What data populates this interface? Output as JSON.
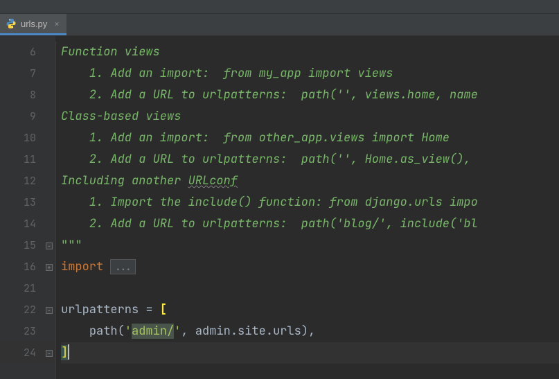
{
  "tab": {
    "filename": "urls.py",
    "icon": "python-file-icon",
    "close_glyph": "×"
  },
  "gutter": {
    "lines": [
      "6",
      "7",
      "8",
      "9",
      "10",
      "11",
      "12",
      "13",
      "14",
      "15",
      "16",
      "21",
      "22",
      "23",
      "24"
    ]
  },
  "fold_markers": {
    "line15": "-",
    "line16": "+",
    "line22": "-",
    "line24": "-"
  },
  "code": {
    "l6": "Function views",
    "l7": "    1. Add an import:  from my_app import views",
    "l8": "    2. Add a URL to urlpatterns:  path('', views.home, name",
    "l9": "Class-based views",
    "l10": "    1. Add an import:  from other_app.views import Home",
    "l11": "    2. Add a URL to urlpatterns:  path('', Home.as_view(), ",
    "l12a": "Including another ",
    "l12b": "URLconf",
    "l13": "    1. Import the include() function: from django.urls impo",
    "l14": "    2. Add a URL to urlpatterns:  path('blog/', include('bl",
    "l15": "\"\"\"",
    "l16_kw": "import",
    "l16_folded": "...",
    "l22_ident": "urlpatterns ",
    "l22_eq": "=",
    "l22_bracket": " [",
    "l23_indent": "    ",
    "l23_func": "path(",
    "l23_q1": "'",
    "l23_str": "admin/",
    "l23_q2": "'",
    "l23_mid": ", admin.site.urls)",
    "l23_comma": ",",
    "l24_close": "]"
  }
}
